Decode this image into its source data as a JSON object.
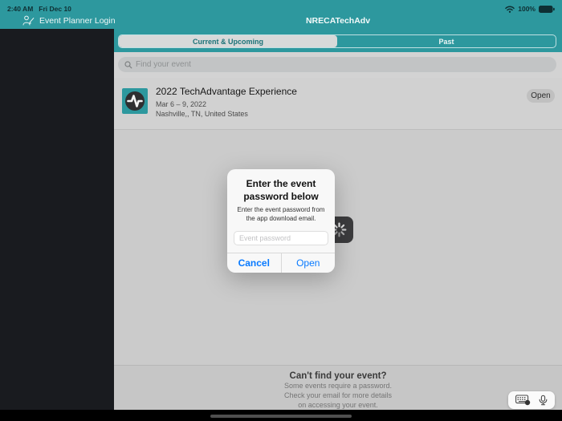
{
  "colors": {
    "teal": "#2d989e",
    "accent_blue": "#097aff"
  },
  "status_bar": {
    "time": "2:40 AM",
    "date": "Fri Dec 10",
    "battery_percent": "100%"
  },
  "nav": {
    "login_label": "Event Planner Login",
    "title": "NRECATechAdv"
  },
  "tabs": {
    "current_label": "Current & Upcoming",
    "past_label": "Past"
  },
  "search": {
    "placeholder": "Find your event"
  },
  "event": {
    "title": "2022 TechAdvantage Experience",
    "dates": "Mar 6 – 9, 2022",
    "location": "Nashville,, TN, United States",
    "open_label": "Open"
  },
  "dialog": {
    "title": "Enter the event password below",
    "message": "Enter the event password from the app download email.",
    "input_placeholder": "Event password",
    "cancel_label": "Cancel",
    "open_label": "Open"
  },
  "footer": {
    "title": "Can't find your event?",
    "lines": [
      "Some events require a password.",
      "Check your email for more details",
      "on accessing your event."
    ]
  }
}
